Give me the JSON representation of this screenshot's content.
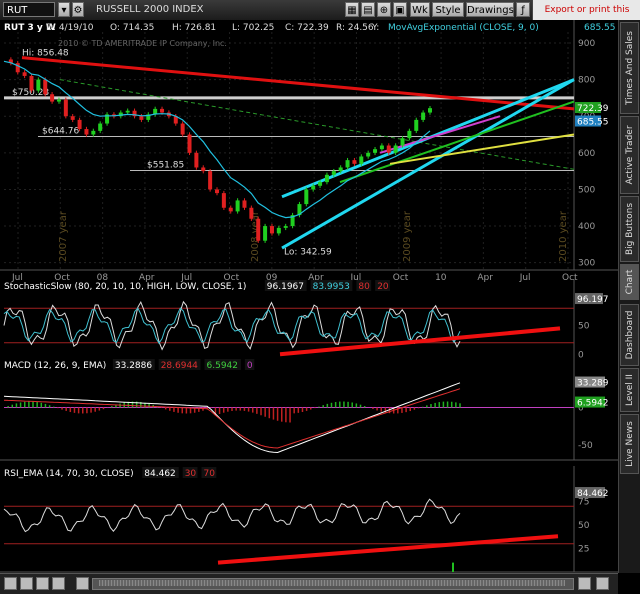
{
  "toolbar": {
    "symbol": "RUT",
    "title": "RUSSELL 2000 INDEX",
    "wk": "Wk",
    "style": "Style",
    "drawings": "Drawings",
    "export": "Export or print this layout"
  },
  "sidebar": [
    "Times And Sales",
    "Active Trader",
    "Big Buttons",
    "Chart",
    "Dashboard",
    "Level II",
    "Live News"
  ],
  "chart_data": [
    {
      "type": "line",
      "title": "RUT 3 y W",
      "quote": {
        "date": "D: 4/19/10",
        "open": "O: 714.35",
        "high": "H: 726.81",
        "low": "L: 702.25",
        "close": "C: 722.39",
        "range": "R: 24.56",
        "y": "Y:"
      },
      "study": "MovAvgExponential (CLOSE, 9, 0)",
      "study_value": "685.55",
      "watermark": "2010 © TD AMERITRADE IP Company, Inc.",
      "x_ticks": [
        "Jul",
        "Oct",
        "08",
        "Apr",
        "Jul",
        "Oct",
        "09",
        "Apr",
        "Jul",
        "Oct",
        "10",
        "Apr",
        "Jul",
        "Oct"
      ],
      "year_labels": [
        "2007 year",
        "2008 year",
        "2009 year",
        "2010 year"
      ],
      "y_ticks": [
        300,
        400,
        500,
        600,
        700,
        800,
        900
      ],
      "ylim": [
        280,
        930
      ],
      "close": [
        855,
        845,
        820,
        810,
        770,
        800,
        760,
        740,
        745,
        700,
        690,
        665,
        650,
        660,
        680,
        705,
        700,
        710,
        715,
        700,
        690,
        705,
        720,
        710,
        700,
        680,
        650,
        600,
        560,
        550,
        500,
        490,
        450,
        440,
        470,
        450,
        420,
        360,
        400,
        380,
        395,
        400,
        430,
        460,
        500,
        510,
        520,
        540,
        550,
        560,
        580,
        570,
        590,
        600,
        610,
        620,
        600,
        620,
        640,
        660,
        690,
        710,
        722
      ],
      "ema": [
        850,
        846,
        838,
        829,
        815,
        812,
        801,
        789,
        780,
        764,
        749,
        732,
        716,
        705,
        700,
        701,
        701,
        703,
        705,
        704,
        701,
        702,
        706,
        707,
        706,
        700,
        690,
        672,
        650,
        630,
        604,
        581,
        555,
        532,
        520,
        506,
        489,
        463,
        451,
        437,
        429,
        423,
        425,
        432,
        446,
        459,
        471,
        485,
        498,
        510,
        524,
        533,
        544,
        555,
        566,
        577,
        582,
        590,
        600,
        612,
        628,
        644,
        660
      ],
      "levels": [
        {
          "label": "$750.23",
          "value": 750.23
        },
        {
          "label": "$644.76",
          "value": 644.76
        },
        {
          "label": "$551.85",
          "value": 551.85
        }
      ],
      "annotations": [
        "Hi: 856.48",
        "Lo: 342.59"
      ],
      "right_labels": [
        "722.39",
        "685.55"
      ]
    },
    {
      "type": "line",
      "title": "StochasticSlow (80, 20, 10, 10, HIGH, LOW, CLOSE, 1)",
      "values_text": [
        "96.1967",
        "83.9953",
        "80",
        "20"
      ],
      "y_ticks": [
        0,
        50
      ],
      "ylim": [
        -10,
        110
      ],
      "right_label": "96.197"
    },
    {
      "type": "bar",
      "title": "MACD (12, 26, 9, EMA)",
      "values_text": [
        "33.2886",
        "28.6944",
        "6.5942",
        "0"
      ],
      "y_ticks": [
        0,
        -50
      ],
      "ylim": [
        -70,
        50
      ],
      "right_labels": [
        "33.289",
        "6.5942"
      ]
    },
    {
      "type": "line",
      "title": "RSI_EMA (14, 70, 30, CLOSE)",
      "values_text": [
        "84.462",
        "30",
        "70"
      ],
      "y_ticks": [
        25,
        50,
        75
      ],
      "ylim": [
        0,
        100
      ],
      "right_label": "84.462"
    }
  ]
}
